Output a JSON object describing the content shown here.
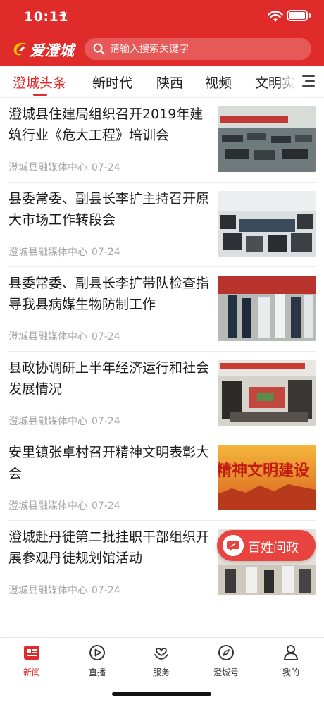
{
  "status": {
    "time": "10:11"
  },
  "header": {
    "logo_text": "爱澄城",
    "search_placeholder": "请输入搜索关键字"
  },
  "tabs": [
    {
      "label": "澄城头条",
      "active": true
    },
    {
      "label": "新时代"
    },
    {
      "label": "陕西"
    },
    {
      "label": "视频"
    },
    {
      "label": "文明实"
    }
  ],
  "news": [
    {
      "title": "澄城县住建局组织召开2019年建筑行业《危大工程》培训会",
      "source": "澄城县融媒体中心",
      "date": "07-24",
      "thumb": "meeting-room"
    },
    {
      "title": "县委常委、副县长李扩主持召开原大市场工作转段会",
      "source": "澄城县融媒体中心",
      "date": "07-24",
      "thumb": "conference-table"
    },
    {
      "title": "县委常委、副县长李扩带队检查指导我县病媒生物防制工作",
      "source": "澄城县融媒体中心",
      "date": "07-24",
      "thumb": "inspection-group"
    },
    {
      "title": "县政协调研上半年经济运行和社会发展情况",
      "source": "澄城县融媒体中心",
      "date": "07-24",
      "thumb": "meeting-banner"
    },
    {
      "title": "安里镇张卓村召开精神文明表彰大会",
      "source": "澄城县融媒体中心",
      "date": "07-24",
      "thumb": "civilization-banner"
    },
    {
      "title": "澄城赴丹徒第二批挂职干部组织开展参观丹徒规划馆活动",
      "source": "澄城县融媒体中心",
      "date": "07-24",
      "thumb": "exhibition-visit"
    }
  ],
  "thumb_banner_text": "精神文明建设",
  "fab": {
    "label": "百姓问政",
    "icon": "chat-bubble-icon"
  },
  "tabbar": [
    {
      "label": "新闻",
      "icon": "news-icon",
      "active": true
    },
    {
      "label": "直播",
      "icon": "play-icon"
    },
    {
      "label": "服务",
      "icon": "service-icon"
    },
    {
      "label": "澄城号",
      "icon": "compass-icon"
    },
    {
      "label": "我的",
      "icon": "user-icon"
    }
  ],
  "colors": {
    "brand": "#e02b2b",
    "meta": "#a8a8a8"
  }
}
